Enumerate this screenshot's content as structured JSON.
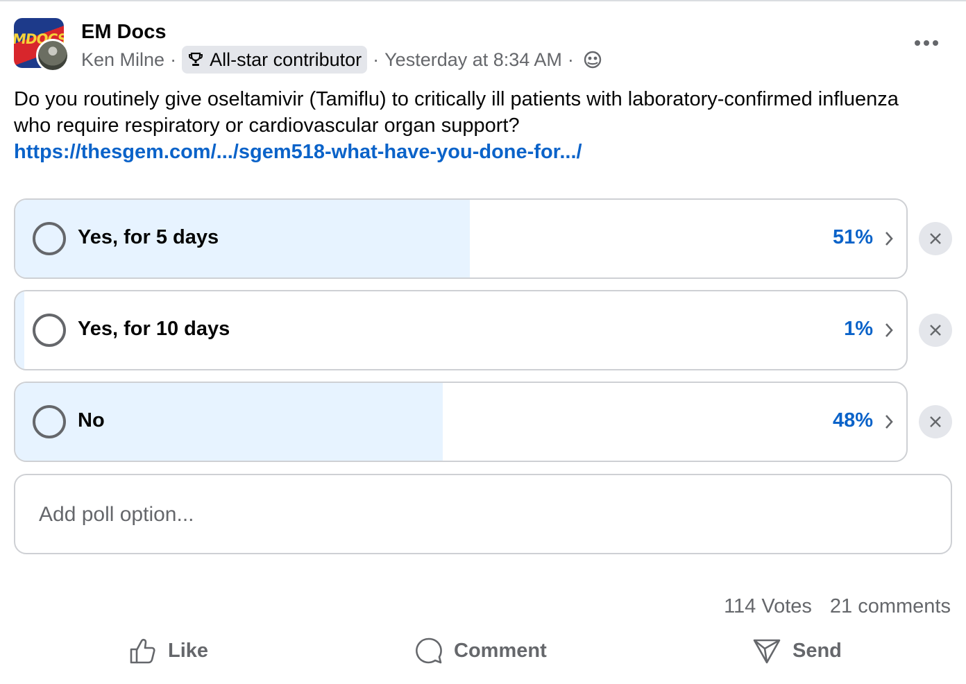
{
  "header": {
    "group_name": "EM Docs",
    "group_logo_text": "MDOCS",
    "author": "Ken Milne",
    "separator": "·",
    "badge": "All-star contributor",
    "timestamp": "Yesterday at 8:34 AM",
    "privacy_icon": "globe-icon",
    "more_icon": "more-options-icon"
  },
  "post": {
    "text": "Do you routinely give oseltamivir (Tamiflu) to critically ill patients with laboratory-confirmed influenza who require respiratory or cardiovascular organ support?",
    "link": "https://thesgem.com/.../sgem518-what-have-you-done-for.../"
  },
  "poll": {
    "options": [
      {
        "label": "Yes, for 5 days",
        "percent_text": "51%",
        "fraction": 0.51
      },
      {
        "label": "Yes, for 10 days",
        "percent_text": "1%",
        "fraction": 0.01
      },
      {
        "label": "No",
        "percent_text": "48%",
        "fraction": 0.48
      }
    ],
    "add_option_placeholder": "Add poll option...",
    "votes": "114 Votes",
    "comments": "21 comments"
  },
  "actions": {
    "like": "Like",
    "comment": "Comment",
    "send": "Send"
  },
  "colors": {
    "link": "#0b63c9",
    "poll_fill": "#e7f3ff",
    "secondary_text": "#65676b"
  }
}
